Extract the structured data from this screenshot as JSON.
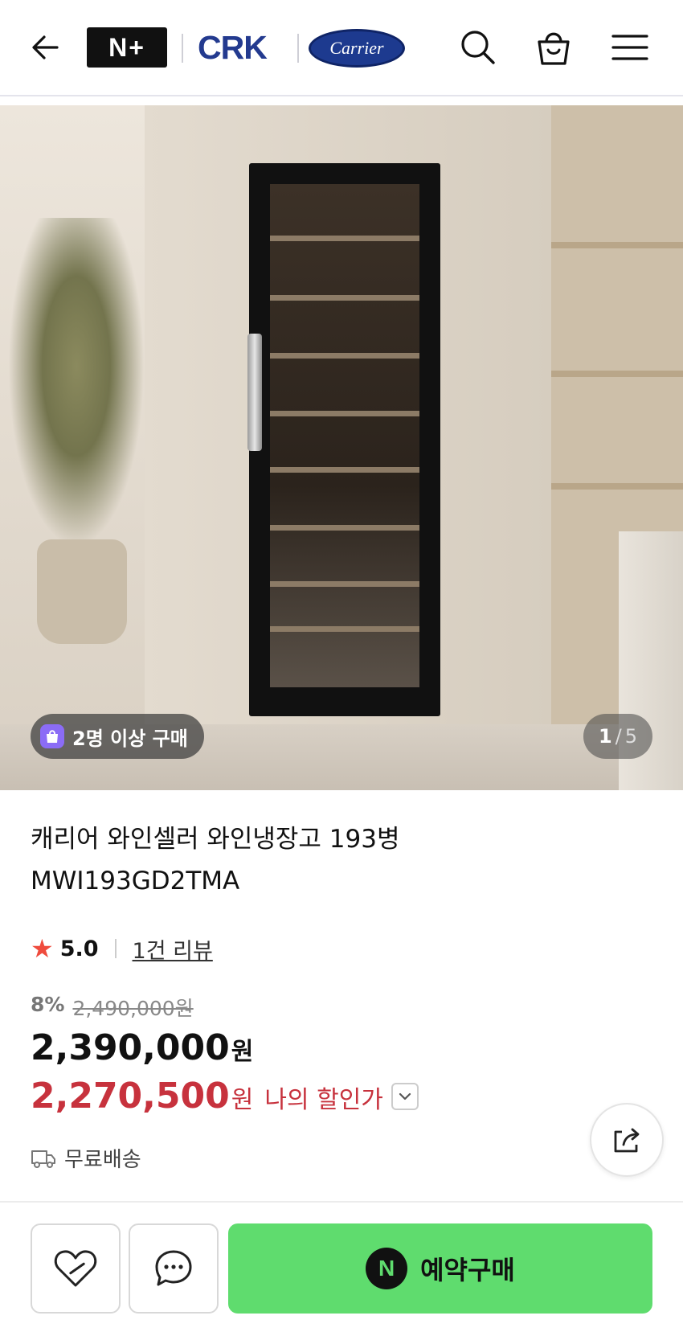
{
  "header": {
    "back_icon": "arrow-left-icon",
    "logo_nplus": "N+",
    "logo_crk": "CRK",
    "logo_carrier": "Carrier",
    "search_icon": "search-icon",
    "bag_icon": "shopping-bag-icon",
    "menu_icon": "hamburger-menu-icon"
  },
  "hero": {
    "badge_label": "2명 이상 구매",
    "image_index": "1",
    "image_total": "5"
  },
  "product": {
    "title": "캐리어 와인셀러 와인냉장고 193병 MWI193GD2TMA",
    "rating": "5.0",
    "review_link": "1건 리뷰",
    "discount_pct": "8%",
    "original_price": "2,490,000원",
    "price": "2,390,000",
    "price_unit": "원",
    "my_price": "2,270,500",
    "my_price_unit": "원",
    "my_price_label": "나의 할인가",
    "shipping": "무료배송"
  },
  "bottom_bar": {
    "wish_icon": "heart-icon",
    "chat_icon": "chat-bubble-icon",
    "buy_label": "예약구매",
    "naverpay_icon": "N"
  },
  "colors": {
    "accent_green": "#5fdc6e",
    "discount_red": "#c7323d",
    "star": "#ef4b3d",
    "brand_blue": "#233a8f"
  }
}
